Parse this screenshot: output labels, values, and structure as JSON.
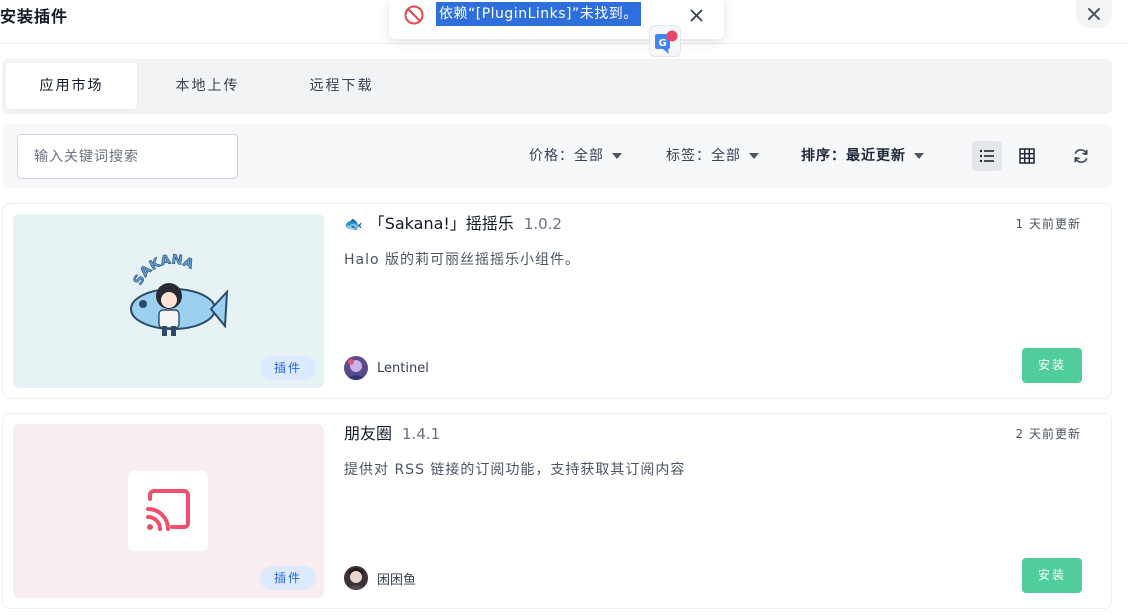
{
  "modal": {
    "title": "安装插件",
    "close_icon": "close-icon"
  },
  "toast": {
    "message": "依赖“[PluginLinks]”未找到。",
    "icon": "forbidden-icon",
    "close_icon": "close-icon",
    "accent": "#e5484d",
    "highlight": "#2f6fdd"
  },
  "tabs": [
    {
      "label": "应用市场",
      "active": true
    },
    {
      "label": "本地上传",
      "active": false
    },
    {
      "label": "远程下载",
      "active": false
    }
  ],
  "filters": {
    "search_placeholder": "输入关键词搜索",
    "price": "价格：全部",
    "tag": "标签：全部",
    "sort": "排序：最近更新",
    "view_list_icon": "list-icon",
    "view_grid_icon": "grid-icon",
    "refresh_icon": "refresh-icon"
  },
  "plugins": [
    {
      "emoji": "🐟",
      "name": "「Sakana!」摇摇乐",
      "version": "1.0.2",
      "updated": "1 天前更新",
      "description": "Halo 版的莉可丽丝摇摇乐小组件。",
      "author": "Lentinel",
      "type": "插件",
      "install": "安装",
      "thumb_bg": "#e6f2f3"
    },
    {
      "emoji": "",
      "name": "朋友圈",
      "version": "1.4.1",
      "updated": "2 天前更新",
      "description": "提供对 RSS 链接的订阅功能，支持获取其订阅内容",
      "author": "困困鱼",
      "type": "插件",
      "install": "安装",
      "thumb_bg": "#f8eeef"
    }
  ],
  "colors": {
    "install_button": "#4fce9c",
    "badge_bg": "#dbeafe",
    "badge_text": "#2563eb",
    "rss_icon": "#f0506e"
  }
}
